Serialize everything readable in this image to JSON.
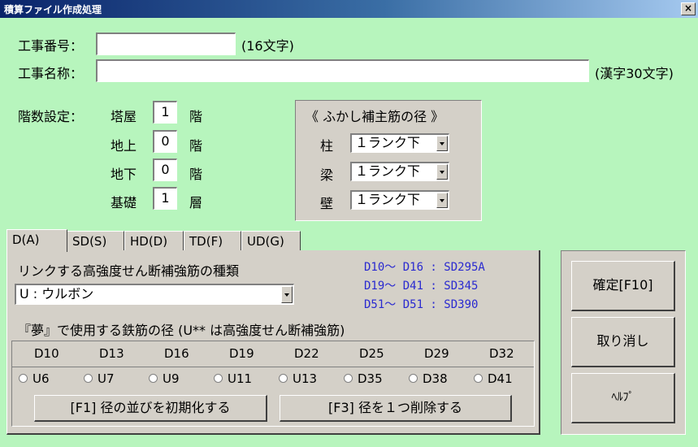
{
  "window": {
    "title": "積算ファイル作成処理",
    "close_glyph": "×"
  },
  "project": {
    "number_label": "工事番号：",
    "number_value": "",
    "number_hint": "(16文字)",
    "name_label": "工事名称：",
    "name_value": "",
    "name_hint": "(漢字30文字)"
  },
  "floors": {
    "label": "階数設定：",
    "rows": [
      {
        "label": "塔屋",
        "value": "1",
        "unit": "階"
      },
      {
        "label": "地上",
        "value": "0",
        "unit": "階"
      },
      {
        "label": "地下",
        "value": "0",
        "unit": "階"
      },
      {
        "label": "基礎",
        "value": "1",
        "unit": "層"
      }
    ]
  },
  "fukashi": {
    "title": "《 ふかし補主筋の径 》",
    "rows": [
      {
        "label": "柱",
        "value": "１ランク下"
      },
      {
        "label": "梁",
        "value": "１ランク下"
      },
      {
        "label": "壁",
        "value": "１ランク下"
      }
    ]
  },
  "tabs": [
    {
      "label": "D(A)",
      "active": true
    },
    {
      "label": "SD(S)",
      "active": false
    },
    {
      "label": "HD(D)",
      "active": false
    },
    {
      "label": "TD(F)",
      "active": false
    },
    {
      "label": "UD(G)",
      "active": false
    }
  ],
  "rebar": {
    "link_label": "リンクする高強度せん断補強筋の種類",
    "link_value": "U : ウルボン",
    "notes": [
      "D10～ D16 : SD295A",
      "D19～ D41 : SD345",
      "D51～ D51 : SD390"
    ],
    "diameter_label": "『夢』で使用する鉄筋の径 (U** は高強度せん断補強筋)",
    "columns": [
      "D10",
      "D13",
      "D16",
      "D19",
      "D22",
      "D25",
      "D29",
      "D32"
    ],
    "options": [
      "U6",
      "U7",
      "U9",
      "U11",
      "U13",
      "D35",
      "D38",
      "D41"
    ],
    "init_button": "[F1] 径の並びを初期化する",
    "delete_button": "[F3] 径を１つ削除する"
  },
  "actions": {
    "confirm": "確定[F10]",
    "cancel": "取り消し",
    "help": "ﾍﾙﾌﾟ"
  },
  "colors": {
    "background": "#b7f5bd",
    "panel": "#d4d0c8",
    "note_text": "#2a2ad0",
    "title_bar": "#0a246a"
  }
}
